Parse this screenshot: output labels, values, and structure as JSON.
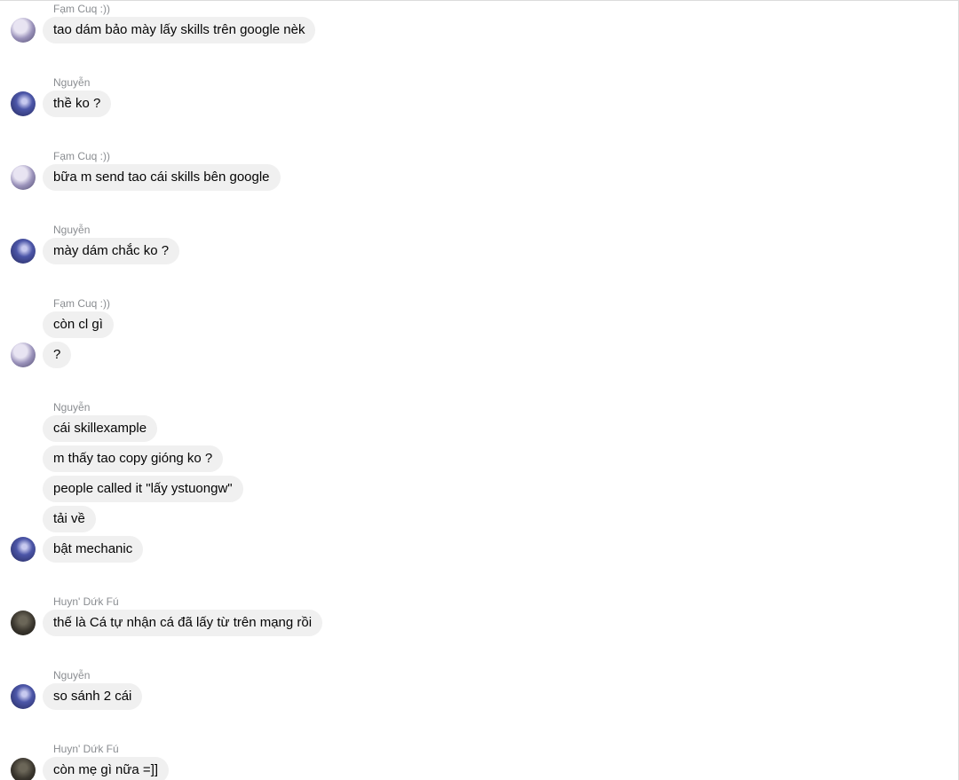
{
  "groups": [
    {
      "sender": "Fạm Cuq :))",
      "avatar": "fam",
      "messages": [
        "tao dám bảo mày lấy skills trên google nèk"
      ]
    },
    {
      "sender": "Nguyễn",
      "avatar": "nguyen",
      "messages": [
        "thề ko ?"
      ]
    },
    {
      "sender": "Fạm Cuq :))",
      "avatar": "fam",
      "messages": [
        "bữa m send tao cái skills bên google"
      ]
    },
    {
      "sender": "Nguyễn",
      "avatar": "nguyen",
      "messages": [
        "mày dám chắc ko ?"
      ]
    },
    {
      "sender": "Fạm Cuq :))",
      "avatar": "fam",
      "messages": [
        "còn cl gì",
        "?"
      ]
    },
    {
      "sender": "Nguyễn",
      "avatar": "nguyen",
      "messages": [
        "cái skillexample",
        "m thấy tao copy  gióng ko ?",
        "people called it \"lấy ystuongw\"",
        "tải về",
        "bật mechanic"
      ]
    },
    {
      "sender": "Huyn' Dứk Fú",
      "avatar": "huyn",
      "messages": [
        "thế là Cá tự nhận cá đã lấy từ trên mạng rồi"
      ]
    },
    {
      "sender": "Nguyễn",
      "avatar": "nguyen",
      "messages": [
        "so sánh 2 cái"
      ]
    },
    {
      "sender": "Huyn' Dứk Fú",
      "avatar": "huyn",
      "messages": [
        "còn mẹ gì nữa =]]"
      ]
    }
  ]
}
